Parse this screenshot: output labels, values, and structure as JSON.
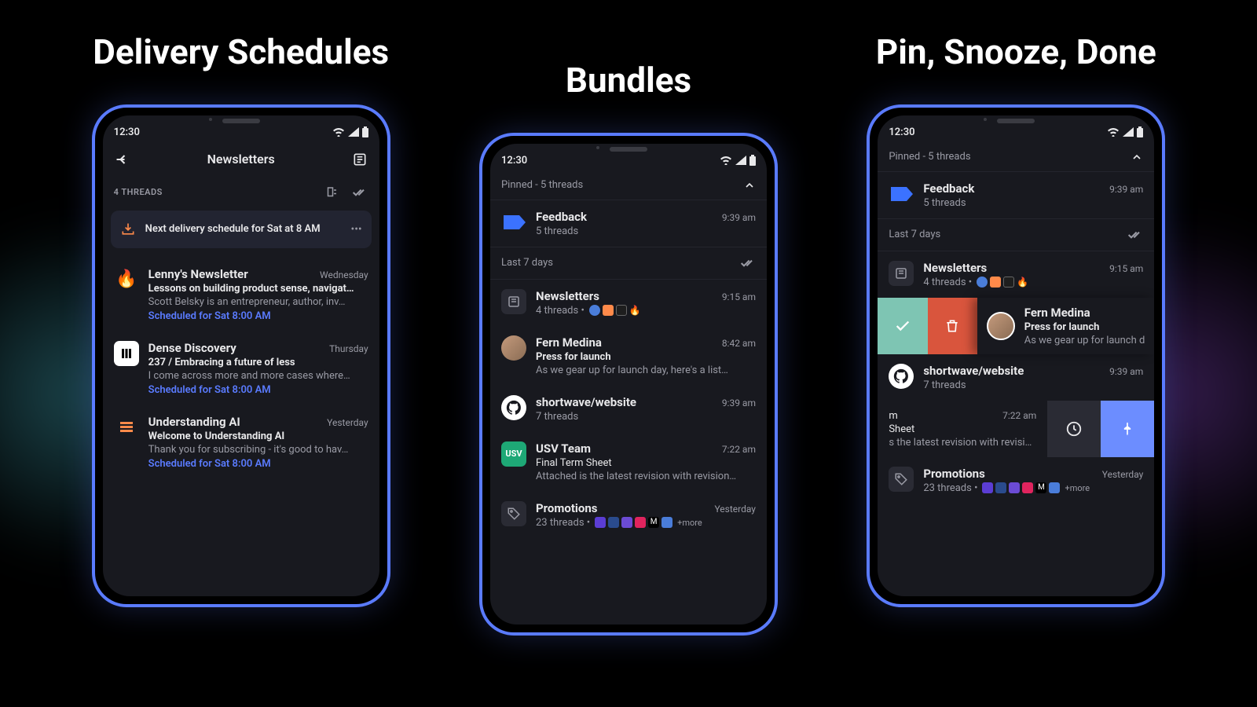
{
  "titles": {
    "p1": "Delivery Schedules",
    "p2": "Bundles",
    "p3": "Pin, Snooze, Done"
  },
  "status_time": "12:30",
  "p1": {
    "header": "Newsletters",
    "threads_count": "4 THREADS",
    "schedule_text": "Next delivery schedule for Sat at 8 AM",
    "items": [
      {
        "emoji": "🔥",
        "title": "Lenny's Newsletter",
        "time": "Wednesday",
        "subject": "Lessons on building product sense, navigat…",
        "preview": "Scott Belsky is an entrepreneur, author, inv…",
        "scheduled": "Scheduled for Sat 8:00 AM"
      },
      {
        "emoji": "dd",
        "title": "Dense Discovery",
        "time": "Thursday",
        "subject": "237 / Embracing a future of less",
        "preview": "I come across more and more cases where…",
        "scheduled": "Scheduled for Sat 8:00 AM"
      },
      {
        "emoji": "ua",
        "title": "Understanding AI",
        "time": "Yesterday",
        "subject": "Welcome to Understanding AI",
        "preview": "Thank you for subscribing - it's good to hav…",
        "scheduled": "Scheduled for Sat 8:00 AM"
      }
    ]
  },
  "p2": {
    "pinned_header": "Pinned - 5 threads",
    "feedback": {
      "title": "Feedback",
      "sub": "5 threads",
      "time": "9:39 am"
    },
    "last7": "Last 7 days",
    "items": [
      {
        "title": "Newsletters",
        "sub": "4 threads  •",
        "time": "9:15 am"
      },
      {
        "title": "Fern Medina",
        "sub": "Press for launch",
        "preview": "As we gear up for launch day, here's a list…",
        "time": "8:42 am"
      },
      {
        "title": "shortwave/website",
        "sub": "7 threads",
        "time": "9:39 am"
      },
      {
        "title": "USV Team",
        "sub": "Final Term Sheet",
        "preview": "Attached is the latest revision with revision…",
        "time": "7:22 am"
      },
      {
        "title": "Promotions",
        "sub": "23 threads  •",
        "more": "+more",
        "time": "Yesterday"
      }
    ]
  },
  "p3": {
    "pinned_header": "Pinned - 5 threads",
    "feedback": {
      "title": "Feedback",
      "sub": "5 threads",
      "time": "9:39 am"
    },
    "last7": "Last 7 days",
    "newsletters": {
      "title": "Newsletters",
      "sub": "4 threads  •",
      "time": "9:15 am"
    },
    "fern": {
      "title": "Fern Medina",
      "sub": "Press for launch",
      "preview": "As we gear up for launch d"
    },
    "shortwave": {
      "title": "shortwave/website",
      "sub": "7 threads",
      "time": "9:39 am"
    },
    "usv": {
      "line1": "m",
      "line2": "Sheet",
      "line3": "s the latest revision with revision…",
      "time": "7:22 am"
    },
    "promotions": {
      "title": "Promotions",
      "sub": "23 threads  •",
      "more": "+more",
      "time": "Yesterday"
    }
  }
}
